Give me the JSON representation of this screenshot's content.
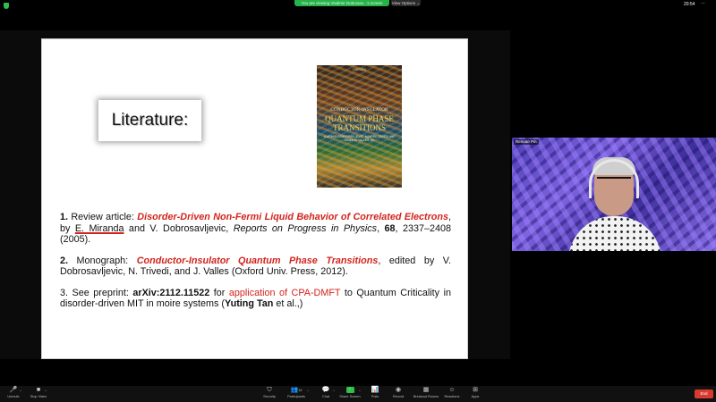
{
  "topbar": {
    "viewing_text": "You are viewing Vladimir Dobrosav...'s screen",
    "view_options_label": "View Options",
    "view_options_caret": "⌄",
    "clock": "20:54",
    "more_icon_glyph": "···"
  },
  "slide": {
    "heading": "Literature:",
    "book": {
      "publisher_line": "OXFORD",
      "subtitle": "CONDUCTOR-INSULATOR",
      "title": "QUANTUM PHASE TRANSITIONS",
      "authors": "VLADIMIR DOBROSAVLJEVIĆ, NANDINI TRIVEDI AND JAMES M. VALLES, JR."
    },
    "refs": [
      {
        "num": "1.",
        "prefix": " Review article: ",
        "title": "Disorder-Driven Non-Fermi Liquid Behavior of Correlated Electrons",
        "by": ", by ",
        "author_u": "E. Miranda",
        "rest1": " and V. Dobrosavljevic, ",
        "journal": "Reports on Progress in Physics",
        "comma": ", ",
        "volume": "68",
        "rest2": ", 2337–2408 (2005)."
      },
      {
        "num": "2.",
        "prefix": " Monograph: ",
        "title": "Conductor-Insulator Quantum Phase Transitions",
        "rest": ", edited by V. Dobrosavljevic, N. Trivedi, and J. Valles (Oxford Univ. Press, 2012)."
      },
      {
        "num": "3.",
        "prefix": " See preprint: ",
        "arxiv": "arXiv:2112.11522",
        "for": " for ",
        "app": "application of CPA-DMFT",
        "rest1": " to  Quantum Criticality in disorder-driven MIT in moire systems (",
        "author": "Yuting Tan",
        "rest2": " et al.,)"
      }
    ]
  },
  "video": {
    "name": "Remote Pin"
  },
  "toolbar": {
    "unmute": "Unmute",
    "stop_video": "Stop Video",
    "security": "Security",
    "participants": "Participants",
    "participants_count": "14",
    "chat": "Chat",
    "share_screen": "Share Screen",
    "polls": "Polls",
    "record": "Record",
    "breakout": "Breakout Rooms",
    "reactions": "Reactions",
    "apps": "Apps",
    "end": "End",
    "caret": "^"
  },
  "colors": {
    "zoom_green": "#27b34a",
    "highlight_red": "#d3231c",
    "end_red": "#d93a2f",
    "toolbar_bg": "#111111"
  },
  "icons": [
    "shield-icon",
    "more-icon",
    "microphone-icon",
    "video-camera-icon",
    "shield-security-icon",
    "participants-icon",
    "chat-icon",
    "share-screen-icon",
    "polls-icon",
    "record-icon",
    "breakout-rooms-icon",
    "reactions-icon",
    "apps-icon"
  ]
}
